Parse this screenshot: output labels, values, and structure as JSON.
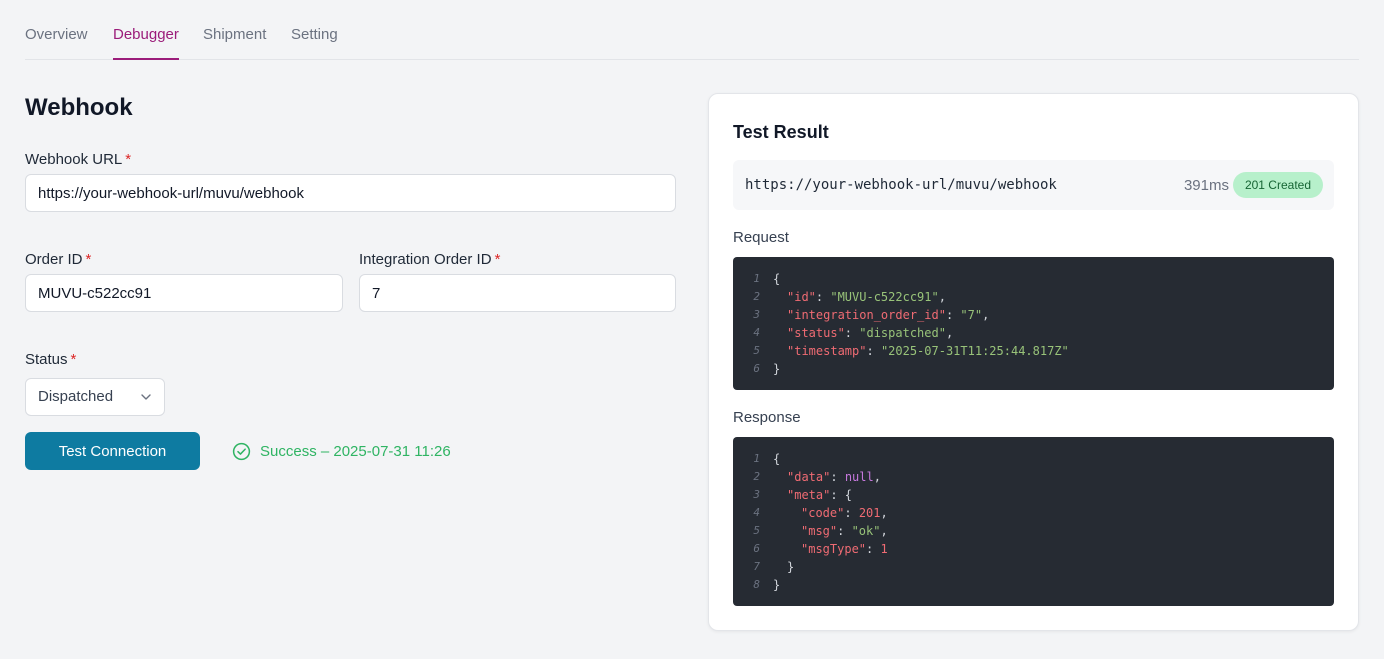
{
  "tabs": [
    {
      "label": "Overview",
      "active": false
    },
    {
      "label": "Debugger",
      "active": true
    },
    {
      "label": "Shipment",
      "active": false
    },
    {
      "label": "Setting",
      "active": false
    }
  ],
  "form": {
    "title": "Webhook",
    "webhook_url_label": "Webhook URL",
    "webhook_url_value": "https://your-webhook-url/muvu/webhook",
    "order_id_label": "Order ID",
    "order_id_value": "MUVU-c522cc91",
    "integration_order_id_label": "Integration Order ID",
    "integration_order_id_value": "7",
    "status_label": "Status",
    "status_value": "Dispatched",
    "required_marker": "*",
    "test_button_label": "Test Connection",
    "success_text": "Success – 2025-07-31 11:26"
  },
  "result": {
    "title": "Test Result",
    "url": "https://your-webhook-url/muvu/webhook",
    "duration": "391ms",
    "status_badge": "201 Created",
    "request_label": "Request",
    "response_label": "Response",
    "request_lines": [
      {
        "n": "1",
        "indent": 0,
        "tokens": [
          {
            "t": "p",
            "v": "{"
          }
        ]
      },
      {
        "n": "2",
        "indent": 1,
        "tokens": [
          {
            "t": "k",
            "v": "\"id\""
          },
          {
            "t": "p",
            "v": ": "
          },
          {
            "t": "s",
            "v": "\"MUVU-c522cc91\""
          },
          {
            "t": "p",
            "v": ","
          }
        ]
      },
      {
        "n": "3",
        "indent": 1,
        "tokens": [
          {
            "t": "k",
            "v": "\"integration_order_id\""
          },
          {
            "t": "p",
            "v": ": "
          },
          {
            "t": "s",
            "v": "\"7\""
          },
          {
            "t": "p",
            "v": ","
          }
        ]
      },
      {
        "n": "4",
        "indent": 1,
        "tokens": [
          {
            "t": "k",
            "v": "\"status\""
          },
          {
            "t": "p",
            "v": ": "
          },
          {
            "t": "s",
            "v": "\"dispatched\""
          },
          {
            "t": "p",
            "v": ","
          }
        ]
      },
      {
        "n": "5",
        "indent": 1,
        "tokens": [
          {
            "t": "k",
            "v": "\"timestamp\""
          },
          {
            "t": "p",
            "v": ": "
          },
          {
            "t": "s",
            "v": "\"2025-07-31T11:25:44.817Z\""
          }
        ]
      },
      {
        "n": "6",
        "indent": 0,
        "tokens": [
          {
            "t": "p",
            "v": "}"
          }
        ]
      }
    ],
    "response_lines": [
      {
        "n": "1",
        "indent": 0,
        "tokens": [
          {
            "t": "p",
            "v": "{"
          }
        ]
      },
      {
        "n": "2",
        "indent": 1,
        "tokens": [
          {
            "t": "k",
            "v": "\"data\""
          },
          {
            "t": "p",
            "v": ": "
          },
          {
            "t": "nl",
            "v": "null"
          },
          {
            "t": "p",
            "v": ","
          }
        ]
      },
      {
        "n": "3",
        "indent": 1,
        "tokens": [
          {
            "t": "k",
            "v": "\"meta\""
          },
          {
            "t": "p",
            "v": ": {"
          }
        ]
      },
      {
        "n": "4",
        "indent": 2,
        "tokens": [
          {
            "t": "k",
            "v": "\"code\""
          },
          {
            "t": "p",
            "v": ": "
          },
          {
            "t": "n",
            "v": "201"
          },
          {
            "t": "p",
            "v": ","
          }
        ]
      },
      {
        "n": "5",
        "indent": 2,
        "tokens": [
          {
            "t": "k",
            "v": "\"msg\""
          },
          {
            "t": "p",
            "v": ": "
          },
          {
            "t": "s",
            "v": "\"ok\""
          },
          {
            "t": "p",
            "v": ","
          }
        ]
      },
      {
        "n": "6",
        "indent": 2,
        "tokens": [
          {
            "t": "k",
            "v": "\"msgType\""
          },
          {
            "t": "p",
            "v": ": "
          },
          {
            "t": "n",
            "v": "1"
          }
        ]
      },
      {
        "n": "7",
        "indent": 1,
        "tokens": [
          {
            "t": "p",
            "v": "}"
          }
        ]
      },
      {
        "n": "8",
        "indent": 0,
        "tokens": [
          {
            "t": "p",
            "v": "}"
          }
        ]
      }
    ]
  },
  "colors": {
    "accent": "#9b1c7a",
    "button": "#0e7ba1",
    "success": "#2fb463",
    "badge_bg": "#b7f0cb",
    "code_bg": "#262b33"
  },
  "icons": {
    "select_chevron": "chevron-down-icon",
    "success": "check-circle-icon"
  }
}
